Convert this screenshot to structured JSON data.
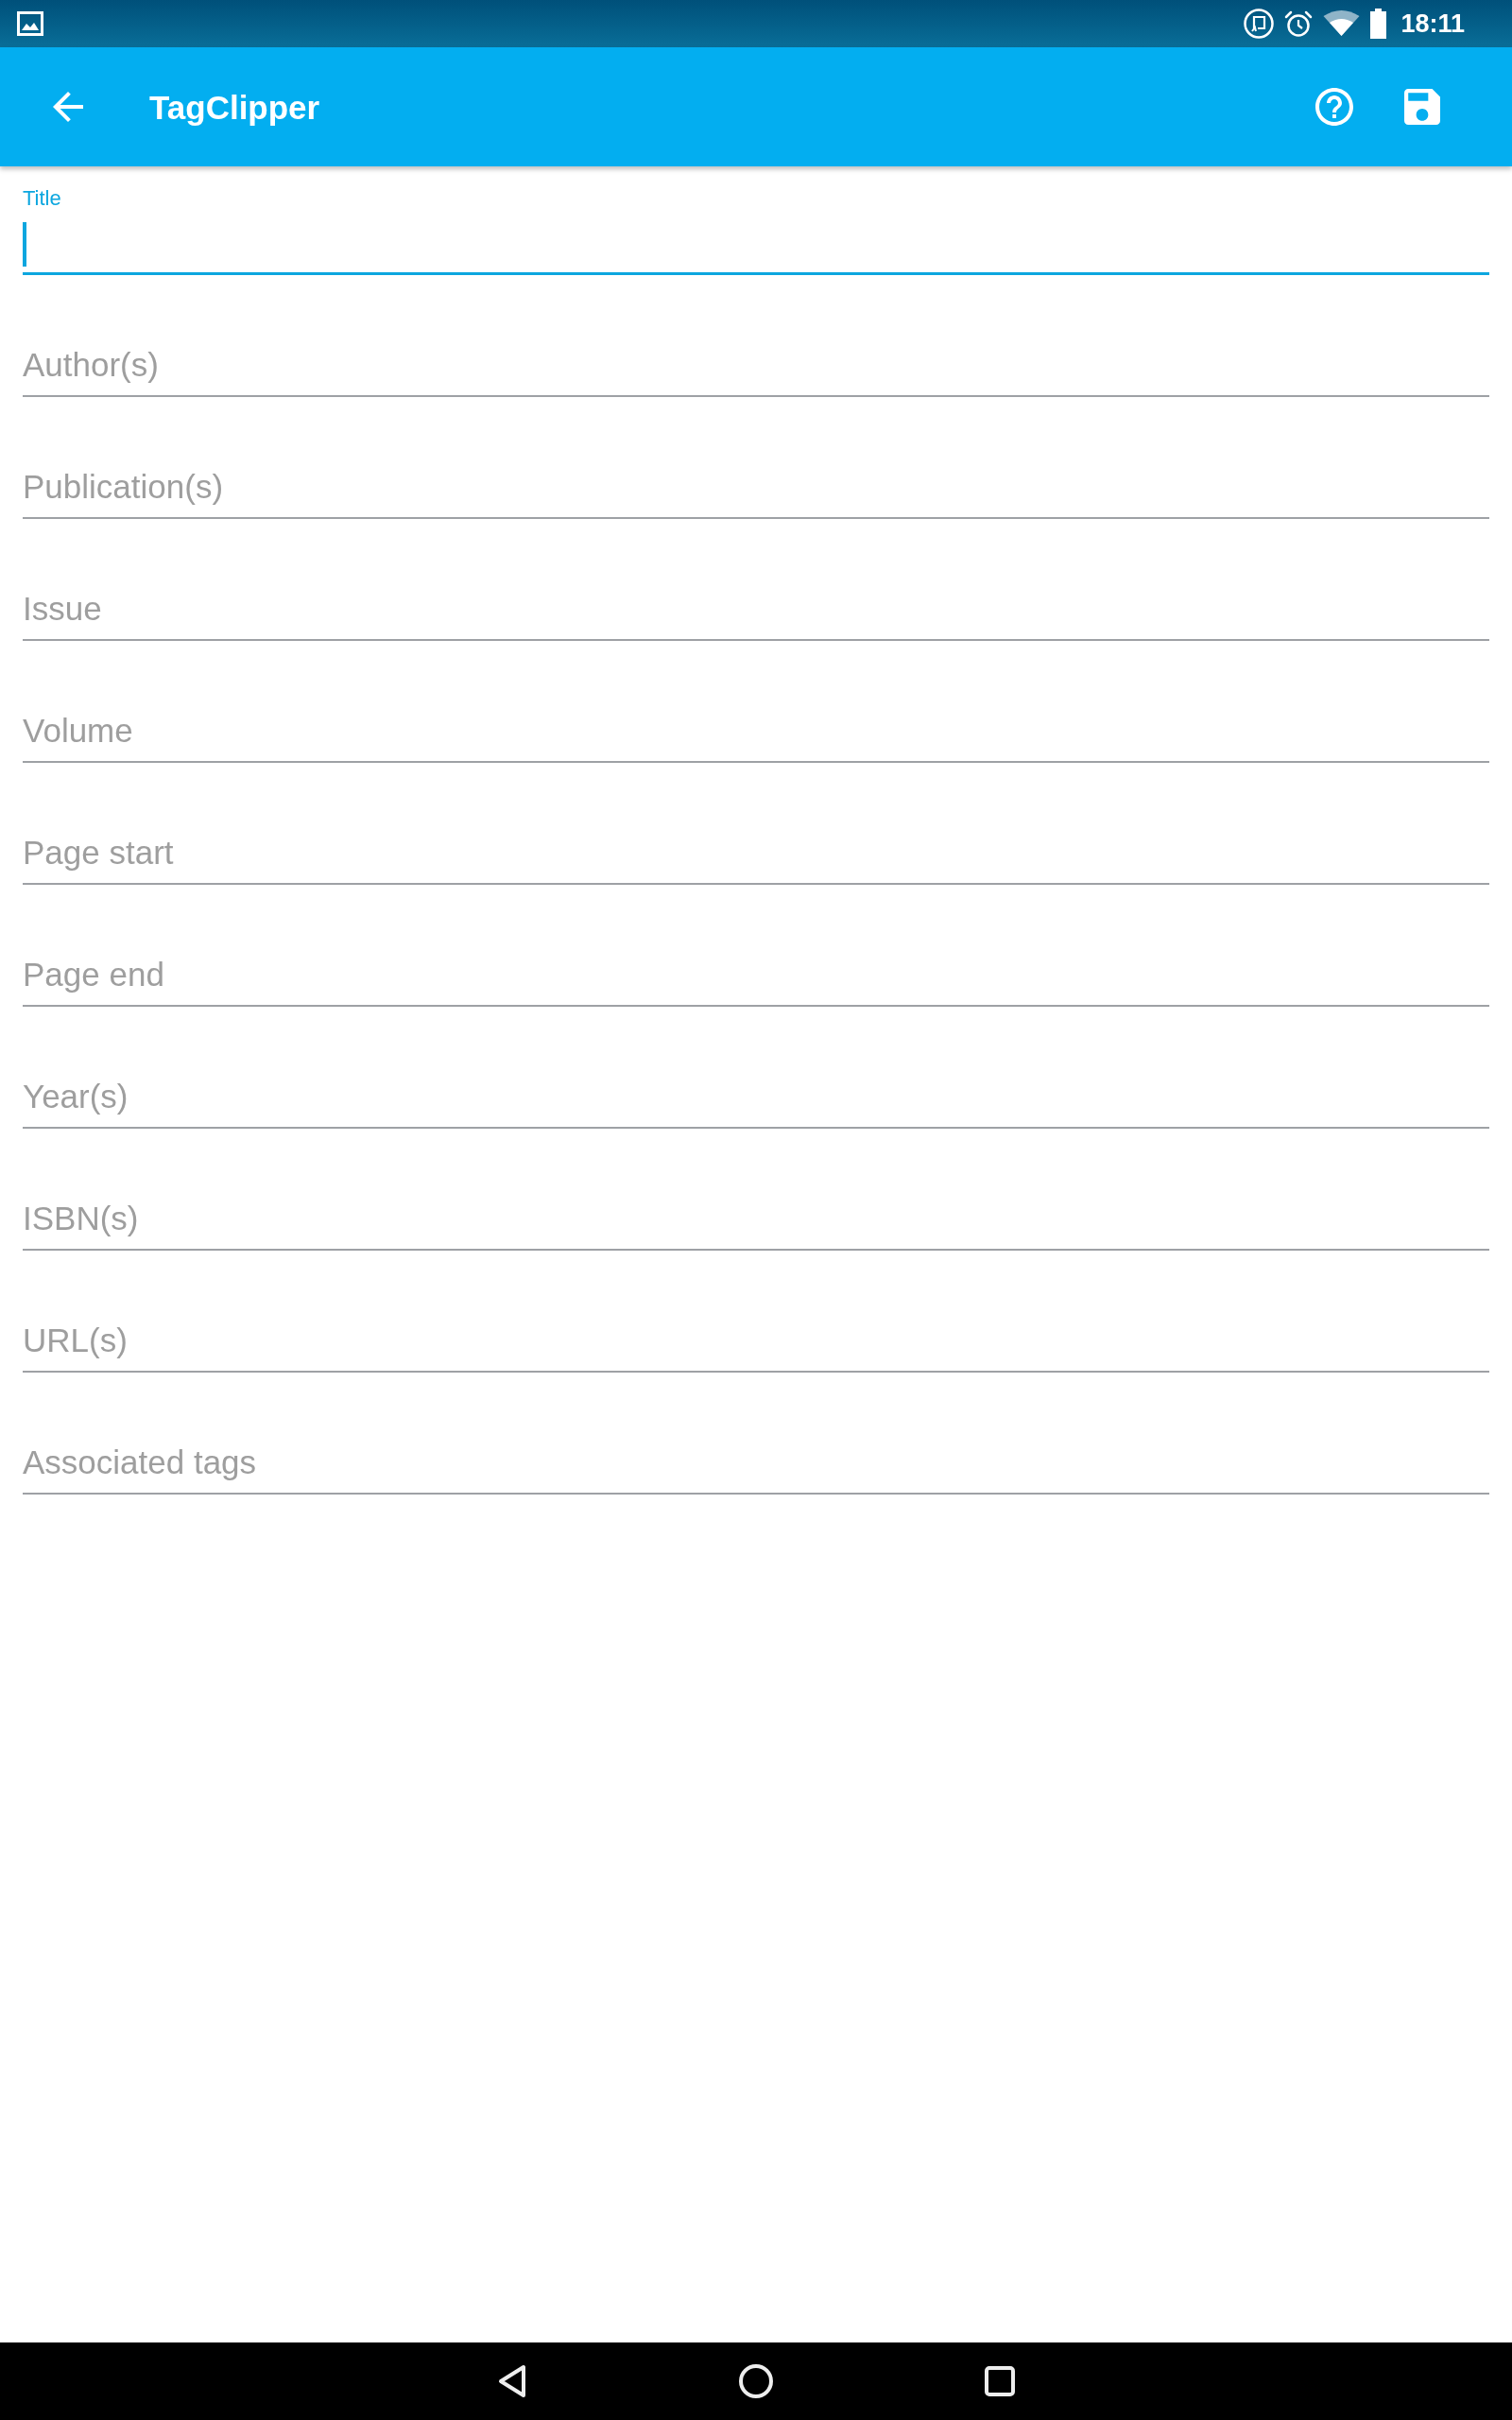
{
  "status_bar": {
    "time": "18:11"
  },
  "app_bar": {
    "title": "TagClipper"
  },
  "fields": [
    {
      "placeholder": "Title",
      "focused": true
    },
    {
      "placeholder": "Author(s)",
      "focused": false
    },
    {
      "placeholder": "Publication(s)",
      "focused": false
    },
    {
      "placeholder": "Issue",
      "focused": false
    },
    {
      "placeholder": "Volume",
      "focused": false
    },
    {
      "placeholder": "Page start",
      "focused": false
    },
    {
      "placeholder": "Page end",
      "focused": false
    },
    {
      "placeholder": "Year(s)",
      "focused": false
    },
    {
      "placeholder": "ISBN(s)",
      "focused": false
    },
    {
      "placeholder": "URL(s)",
      "focused": false
    },
    {
      "placeholder": "Associated tags",
      "focused": false
    }
  ]
}
